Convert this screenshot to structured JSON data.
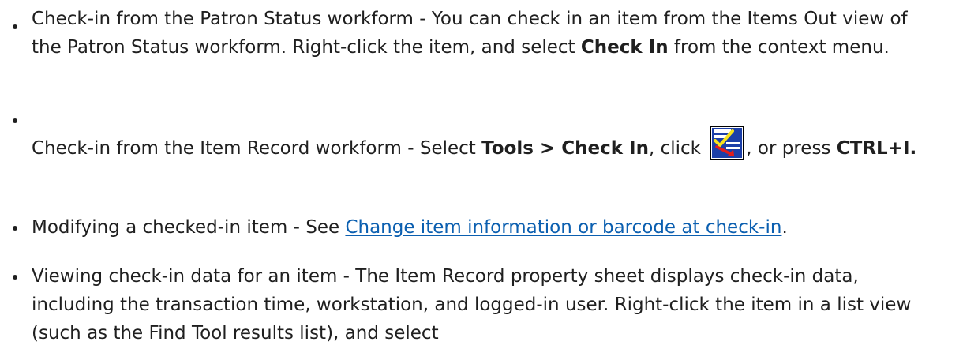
{
  "bullets": [
    {
      "lead": "Check-in from the Patron Status workform - You can check in an item from the Items Out view of the Patron Status workform. Right-click the item, and select ",
      "bold": "Check In",
      "tail": " from the context menu."
    },
    {
      "lead": "Check-in from the Item Record workform - Select ",
      "bold1": "Tools > Check In",
      "mid": ", click ",
      "icon": "check-in-tool-icon",
      "after_icon": ", or press ",
      "bold2": "CTRL+I."
    },
    {
      "lead": "Modifying a checked-in item - See ",
      "link": "Change item information or barcode at check-in",
      "tail": "."
    },
    {
      "text": "Viewing check-in data for an item - The Item Record property sheet displays check-in data, including the transaction time, workstation, and logged-in user. Right-click the item in a list view (such as the Find Tool results list), and select"
    }
  ],
  "colors": {
    "text": "#1f1f1f",
    "link": "#0b5fb0"
  }
}
